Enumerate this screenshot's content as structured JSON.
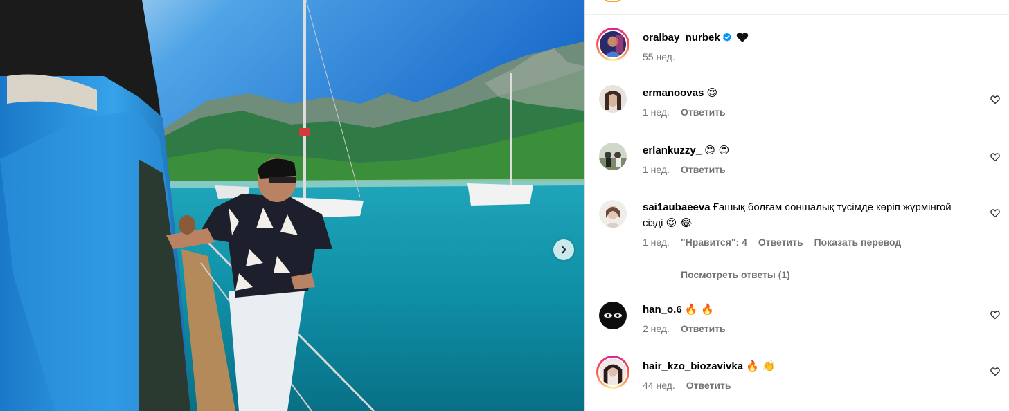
{
  "post": {
    "author": "oralbay_nurbek",
    "author_time": "55 нед."
  },
  "labels": {
    "reply": "Ответить",
    "show_translation": "Показать перевод",
    "view_replies": "Посмотреть ответы (1)"
  },
  "comments": [
    {
      "username": "ermanoovas",
      "text": "",
      "emoji": "😍",
      "time": "1 нед.",
      "likes": ""
    },
    {
      "username": "erlankuzzy_",
      "text": "",
      "emoji": "😍 😍",
      "time": "1 нед.",
      "likes": ""
    },
    {
      "username": "sai1aubaeeva",
      "text": "Ғашық болғам соншалық түсімде көріп жүрмінгой сізді",
      "emoji": "😍 😂",
      "time": "1 нед.",
      "likes": "\"Нравится\": 4"
    },
    {
      "username": "han_o.6",
      "text": "",
      "emoji": "🔥 🔥",
      "time": "2 нед.",
      "likes": ""
    },
    {
      "username": "hair_kzo_biozavivka",
      "text": "",
      "emoji": "🔥 👏",
      "time": "44 нед.",
      "likes": ""
    }
  ],
  "icons": {
    "verified": "verified-badge-icon",
    "black_heart": "black-heart-icon",
    "like": "heart-outline-icon",
    "next": "chevron-right-icon"
  },
  "colors": {
    "verified": "#0095f6",
    "meta_text": "#737373",
    "divider": "#dbdbdb"
  }
}
